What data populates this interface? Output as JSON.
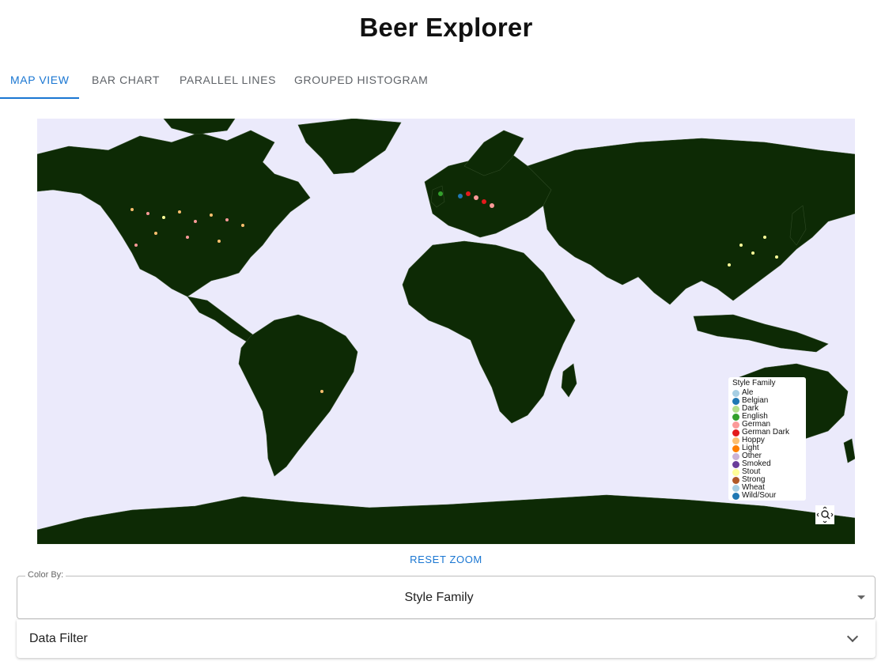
{
  "app": {
    "title": "Beer Explorer"
  },
  "tabs": [
    {
      "label": "MAP VIEW",
      "active": true
    },
    {
      "label": "BAR CHART",
      "active": false
    },
    {
      "label": "PARALLEL LINES",
      "active": false
    },
    {
      "label": "GROUPED HISTOGRAM",
      "active": false
    }
  ],
  "map": {
    "legend": {
      "title": "Style Family",
      "items": [
        {
          "label": "Ale",
          "color": "#a6cee3"
        },
        {
          "label": "Belgian",
          "color": "#1f78b4"
        },
        {
          "label": "Dark",
          "color": "#b2df8a"
        },
        {
          "label": "English",
          "color": "#33a02c"
        },
        {
          "label": "German",
          "color": "#fb9a99"
        },
        {
          "label": "German Dark",
          "color": "#e31a1c"
        },
        {
          "label": "Hoppy",
          "color": "#fdbf6f"
        },
        {
          "label": "Light",
          "color": "#ff7f00"
        },
        {
          "label": "Other",
          "color": "#cab2d6"
        },
        {
          "label": "Smoked",
          "color": "#6a3d9a"
        },
        {
          "label": "Stout",
          "color": "#ffff99"
        },
        {
          "label": "Strong",
          "color": "#b15928"
        },
        {
          "label": "Wheat",
          "color": "#a6cee3"
        },
        {
          "label": "Wild/Sour",
          "color": "#1f78b4"
        }
      ]
    },
    "land_color": "#0d2a05",
    "ocean_color": "#ebeafb",
    "zoom_icon": "zoom-pan-icon"
  },
  "reset_zoom_label": "RESET ZOOM",
  "color_by": {
    "label": "Color By:",
    "value": "Style Family"
  },
  "data_filter": {
    "label": "Data Filter"
  },
  "accent_color": "#1976d2"
}
